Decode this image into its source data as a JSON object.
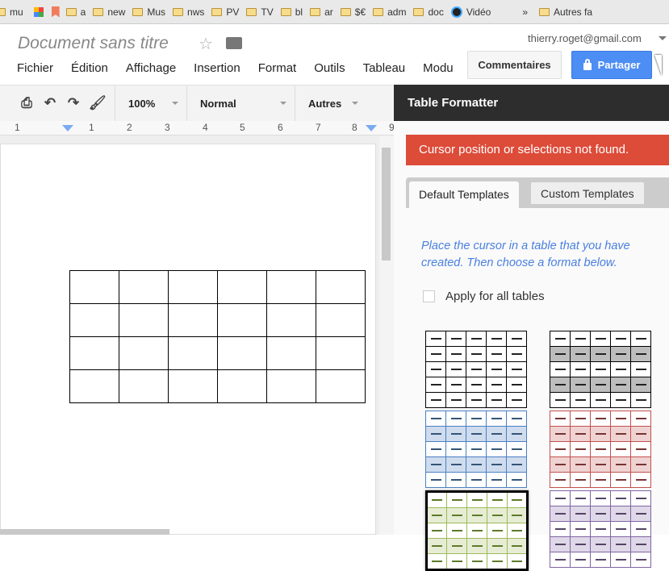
{
  "bookmarks": [
    "mu",
    "a",
    "new",
    "Mus",
    "nws",
    "PV",
    "TV",
    "bl",
    "ar",
    "$€",
    "adm",
    "doc"
  ],
  "bookmark_video": "Vidéo",
  "bookmark_more": "»",
  "bookmark_other": "Autres fa",
  "doc": {
    "title": "Document sans titre",
    "email": "thierry.roget@gmail.com"
  },
  "menu": [
    "Fichier",
    "Édition",
    "Affichage",
    "Insertion",
    "Format",
    "Outils",
    "Tableau",
    "Modu"
  ],
  "buttons": {
    "comments": "Commentaires",
    "share": "Partager"
  },
  "toolbar": {
    "zoom": "100%",
    "style": "Normal",
    "more": "Autres"
  },
  "ruler": [
    "1",
    "1",
    "2",
    "3",
    "4",
    "5",
    "6",
    "7",
    "8",
    "9"
  ],
  "panel": {
    "title": "Table Formatter",
    "error": "Cursor position or selections not found.",
    "tabs": [
      "Default Templates",
      "Custom Templates"
    ],
    "hint": "Place the cursor in a table that you have created. Then choose a format below.",
    "apply_all": "Apply for all tables",
    "templates": [
      {
        "name": "plain-black",
        "border": "#000000",
        "band": "#ffffff",
        "dash": "#222222"
      },
      {
        "name": "gray-banded",
        "border": "#000000",
        "band": "#bdbdbd",
        "dash": "#222222"
      },
      {
        "name": "blue-banded",
        "border": "#4a7fc1",
        "band": "#cfdcee",
        "dash": "#335577"
      },
      {
        "name": "red-banded",
        "border": "#c0504d",
        "band": "#efd3d2",
        "dash": "#773333"
      },
      {
        "name": "green-banded",
        "border": "#9bbb59",
        "band": "#e6edd4",
        "dash": "#5f7a2a",
        "selected": true
      },
      {
        "name": "purple-banded",
        "border": "#8064a2",
        "band": "#dfd8e8",
        "dash": "#554466"
      }
    ]
  }
}
